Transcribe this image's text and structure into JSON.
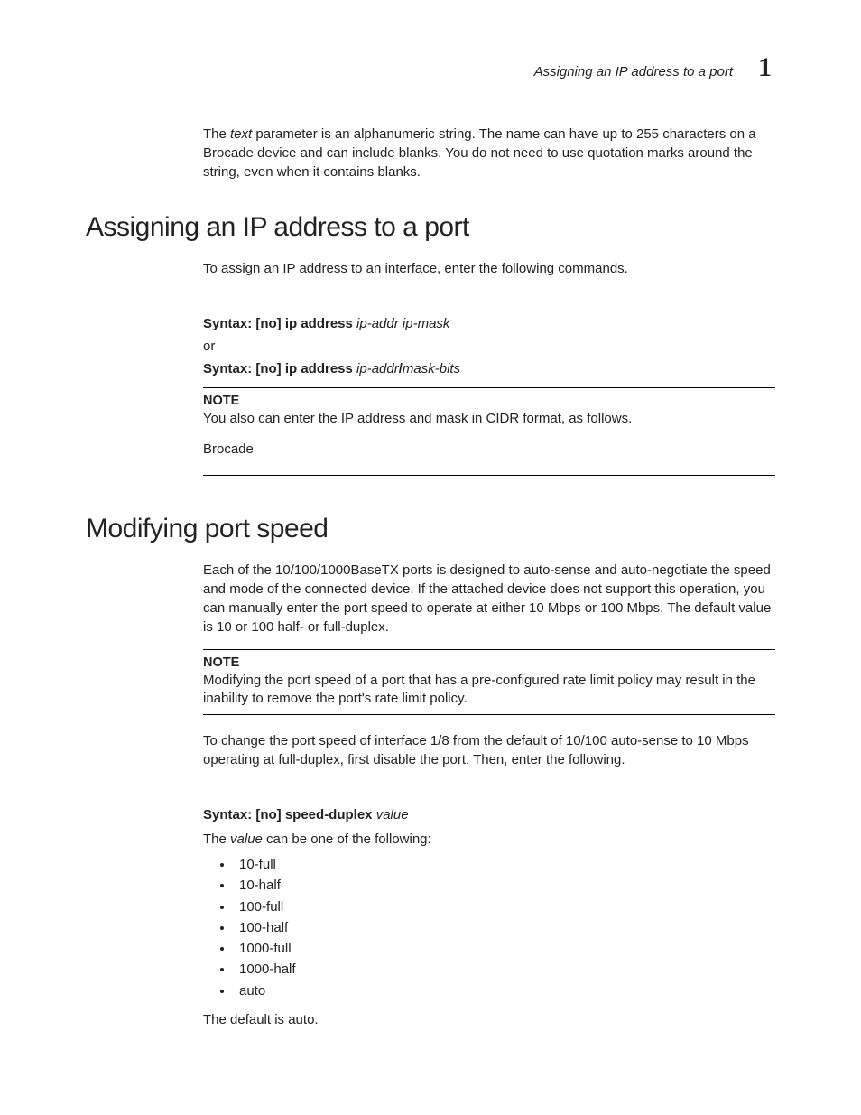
{
  "header": {
    "running_title": "Assigning an IP address to a port",
    "chapter_number": "1"
  },
  "intro_paragraph": {
    "pre": "The ",
    "italic": "text",
    "post": " parameter is an alphanumeric string. The name can have up to 255 characters on a Brocade device and can include blanks. You do not need to use quotation marks around the string, even when it contains blanks."
  },
  "section1": {
    "title": "Assigning an IP address to a port",
    "lead": "To assign an IP address to an interface, enter the following commands.",
    "syntax1": {
      "label": "Syntax:",
      "cmd": " [no] ip address ",
      "var": "ip-addr ip-mask"
    },
    "or": "or",
    "syntax2": {
      "label": "Syntax:",
      "cmd": " [no] ip address ",
      "var1": "ip-addr",
      "slash": "/",
      "var2": "mask-bits"
    },
    "note": {
      "label": "NOTE",
      "text": "You also can enter the IP address and mask in CIDR format, as follows."
    },
    "after_note": "Brocade"
  },
  "section2": {
    "title": "Modifying port speed",
    "lead": "Each of the 10/100/1000BaseTX ports is designed to auto-sense and auto-negotiate the speed and mode of the connected device. If the attached device does not support this operation, you can manually enter the port speed to operate at either 10 Mbps or 100 Mbps. The default value is 10 or 100 half- or full-duplex.",
    "note": {
      "label": "NOTE",
      "text": "Modifying the port speed of a port that has a pre-configured rate limit policy may result in the inability to remove the port's rate limit policy."
    },
    "para2": "To change the port speed of interface 1/8 from the default of 10/100 auto-sense to 10 Mbps operating at full-duplex, first disable the port. Then, enter the following.",
    "syntax": {
      "label": "Syntax:",
      "cmd": " [no] speed-duplex ",
      "var": "value"
    },
    "values_intro_pre": "The ",
    "values_intro_italic": "value",
    "values_intro_post": " can be one of the following:",
    "values": [
      "10-full",
      "10-half",
      "100-full",
      "100-half",
      "1000-full",
      "1000-half",
      "auto"
    ],
    "default_line": "The default is auto."
  }
}
